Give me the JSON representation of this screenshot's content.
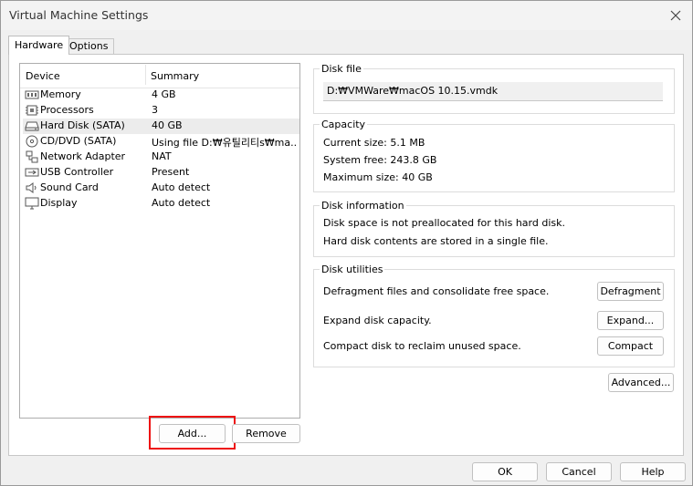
{
  "window": {
    "title": "Virtual Machine Settings"
  },
  "tabs": [
    {
      "label": "Hardware"
    },
    {
      "label": "Options"
    }
  ],
  "device_list": {
    "columns": {
      "device": "Device",
      "summary": "Summary"
    },
    "rows": [
      {
        "name": "Memory",
        "summary": "4 GB",
        "icon": "memory-icon"
      },
      {
        "name": "Processors",
        "summary": "3",
        "icon": "processor-icon"
      },
      {
        "name": "Hard Disk (SATA)",
        "summary": "40 GB",
        "icon": "hard-disk-icon",
        "selected": true
      },
      {
        "name": "CD/DVD (SATA)",
        "summary": "Using file D:₩유틸리티s₩ma...",
        "icon": "cd-dvd-icon"
      },
      {
        "name": "Network Adapter",
        "summary": "NAT",
        "icon": "network-adapter-icon"
      },
      {
        "name": "USB Controller",
        "summary": "Present",
        "icon": "usb-icon"
      },
      {
        "name": "Sound Card",
        "summary": "Auto detect",
        "icon": "speaker-icon"
      },
      {
        "name": "Display",
        "summary": "Auto detect",
        "icon": "monitor-icon"
      }
    ]
  },
  "list_buttons": {
    "add": "Add...",
    "remove": "Remove"
  },
  "disk_file": {
    "title": "Disk file",
    "path": "D:₩VMWare₩macOS 10.15.vmdk"
  },
  "capacity": {
    "title": "Capacity",
    "current": "Current size:  5.1 MB",
    "free": "System free:  243.8 GB",
    "max": "Maximum size:  40 GB"
  },
  "disk_info": {
    "title": "Disk information",
    "line1": "Disk space is not preallocated for this hard disk.",
    "line2": "Hard disk contents are stored in a single file."
  },
  "disk_utils": {
    "title": "Disk utilities",
    "defrag_text": "Defragment files and consolidate free space.",
    "defrag_button": "Defragment",
    "expand_text": "Expand disk capacity.",
    "expand_button": "Expand...",
    "compact_text": "Compact disk to reclaim unused space.",
    "compact_button": "Compact"
  },
  "advanced_button": "Advanced...",
  "dialog_buttons": {
    "ok": "OK",
    "cancel": "Cancel",
    "help": "Help"
  },
  "colors": {
    "highlight": "#e11111",
    "selected_row": "#ececec"
  }
}
